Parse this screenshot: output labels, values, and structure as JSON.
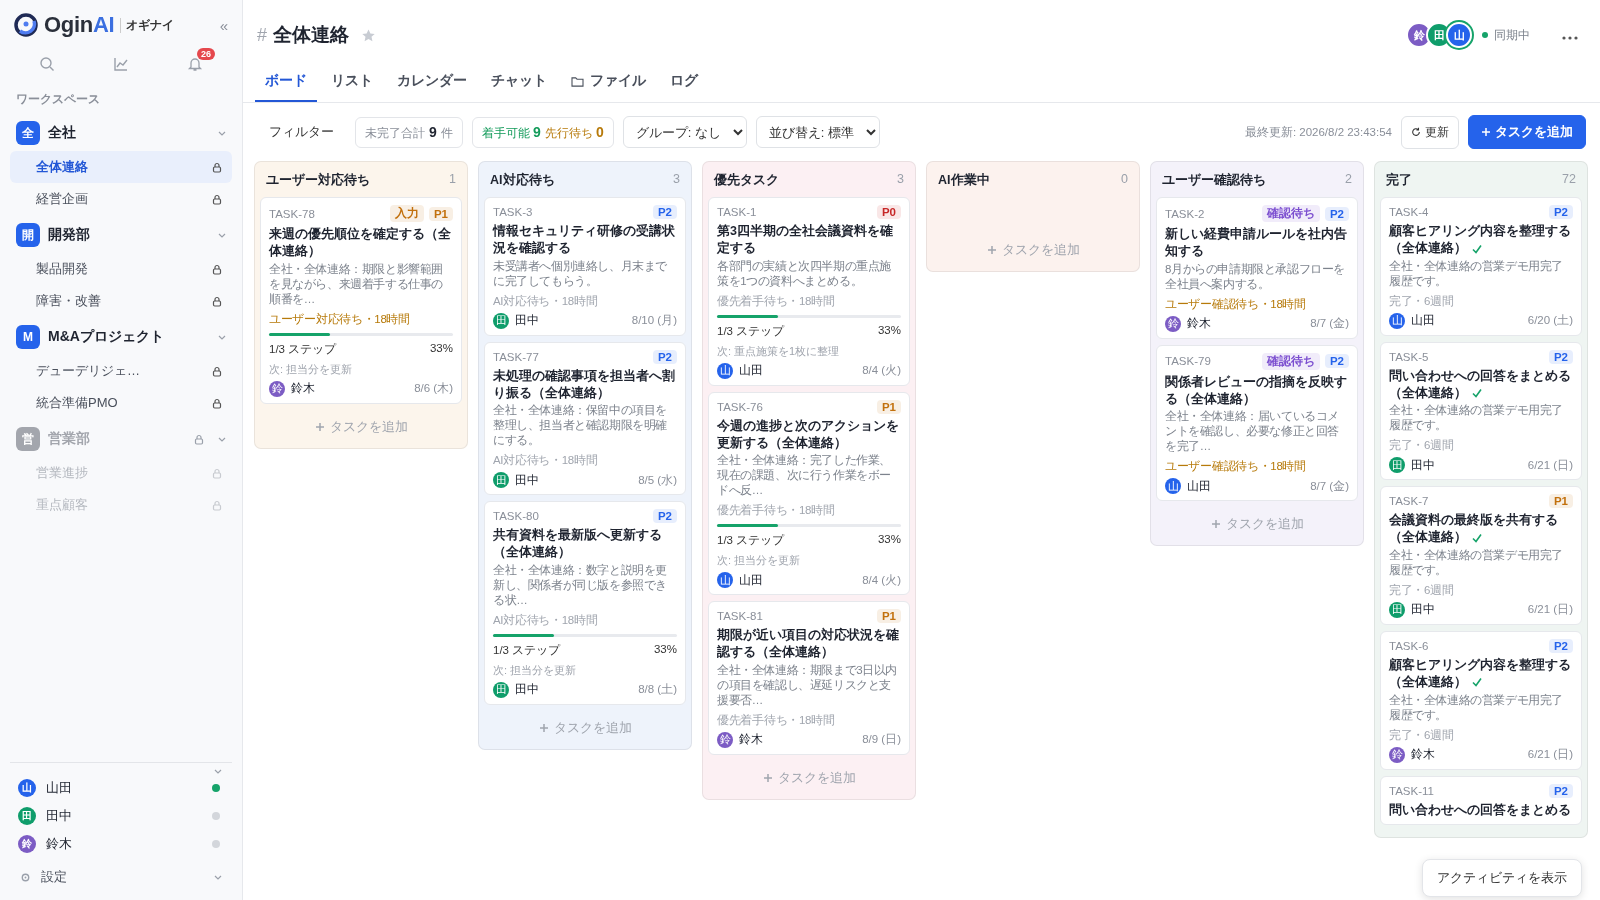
{
  "sidebar": {
    "logo": {
      "text": "Ogin",
      "accent": "AI",
      "sub": "オギナイ"
    },
    "collapse": "«",
    "notifications": "26",
    "section_label": "ワークスペース",
    "groups": [
      {
        "icon": "全",
        "name": "全社",
        "color": "#2563eb",
        "disabled": false,
        "items": [
          {
            "name": "全体連絡",
            "selected": true
          },
          {
            "name": "経営企画",
            "selected": false
          }
        ]
      },
      {
        "icon": "開",
        "name": "開発部",
        "color": "#2563eb",
        "disabled": false,
        "items": [
          {
            "name": "製品開発",
            "selected": false
          },
          {
            "name": "障害・改善",
            "selected": false
          }
        ]
      },
      {
        "icon": "M",
        "name": "M&Aプロジェクト",
        "color": "#2563eb",
        "disabled": false,
        "items": [
          {
            "name": "デューデリジェ…",
            "selected": false
          },
          {
            "name": "統合準備PMO",
            "selected": false
          }
        ]
      },
      {
        "icon": "営",
        "name": "営業部",
        "color": "#a3a6ad",
        "disabled": true,
        "locked": true,
        "items": [
          {
            "name": "営業進捗",
            "selected": false
          },
          {
            "name": "重点顧客",
            "selected": false
          }
        ]
      }
    ],
    "members": [
      {
        "initial": "山",
        "name": "山田",
        "color": "#2563eb",
        "online": true
      },
      {
        "initial": "田",
        "name": "田中",
        "color": "#0f9d6b",
        "online": false
      },
      {
        "initial": "鈴",
        "name": "鈴木",
        "color": "#7c5cc4",
        "online": false
      }
    ],
    "settings": "設定"
  },
  "header": {
    "hash": "#",
    "title": "全体連絡",
    "starred": false,
    "viewers": [
      {
        "initial": "鈴",
        "color": "#7c5cc4"
      },
      {
        "initial": "田",
        "color": "#0f9d6b"
      },
      {
        "initial": "山",
        "color": "#2563eb"
      }
    ],
    "sync": "同期中"
  },
  "tabs": [
    {
      "label": "ボード",
      "selected": true,
      "has_icon": false
    },
    {
      "label": "リスト",
      "selected": false,
      "has_icon": false
    },
    {
      "label": "カレンダー",
      "selected": false,
      "has_icon": false
    },
    {
      "label": "チャット",
      "selected": false,
      "has_icon": false
    },
    {
      "label": "ファイル",
      "selected": false,
      "has_icon": true
    },
    {
      "label": "ログ",
      "selected": false,
      "has_icon": false
    }
  ],
  "toolbar": {
    "filter": "フィルター",
    "open_total": {
      "label": "未完了合計",
      "value": "9",
      "unit": "件"
    },
    "ready": {
      "label": "着手可能",
      "value": "9"
    },
    "blocked": {
      "label": "先行待ち",
      "value": "0"
    },
    "group_select": "グループ: なし",
    "sort_select": "並び替え: 標準",
    "last_updated": "最終更新: 2026/8/2 23:43:54",
    "refresh": "更新",
    "add_task": "タスクを追加"
  },
  "columns": [
    {
      "name": "ユーザー対応待ち",
      "count": "1",
      "color": "#fcf5ec",
      "add": "タスクを追加",
      "cards": [
        {
          "id": "TASK-78",
          "tags": [
            {
              "label": "入力",
              "color": "#c2700c"
            },
            {
              "label": "P1",
              "color": "#c2700c"
            }
          ],
          "title": "来週の優先順位を確定する（全体連絡）",
          "done": false,
          "description": "全社・全体連絡：期限と影響範囲を見ながら、来週着手する仕事の順番を…",
          "status": "ユーザー対応待ち・18時間",
          "alert": true,
          "progress": {
            "level": 0.33,
            "steps": "1/3 ステップ",
            "percent": "33%"
          },
          "next": "次: 担当分を更新",
          "assignee": {
            "initial": "鈴",
            "name": "鈴木",
            "color": "#7c5cc4"
          },
          "due": "8/6 (木)"
        }
      ]
    },
    {
      "name": "AI対応待ち",
      "count": "3",
      "color": "#eef3fb",
      "add": "タスクを追加",
      "cards": [
        {
          "id": "TASK-3",
          "tags": [
            {
              "label": "P2",
              "color": "#2563eb"
            }
          ],
          "title": "情報セキュリティ研修の受講状況を確認する",
          "done": false,
          "description": "未受講者へ個別連絡し、月末までに完了してもらう。",
          "status": "AI対応待ち・18時間",
          "alert": false,
          "assignee": {
            "initial": "田",
            "name": "田中",
            "color": "#0f9d6b"
          },
          "due": "8/10 (月)"
        },
        {
          "id": "TASK-77",
          "tags": [
            {
              "label": "P2",
              "color": "#2563eb"
            }
          ],
          "title": "未処理の確認事項を担当者へ割り振る（全体連絡）",
          "done": false,
          "description": "全社・全体連絡：保留中の項目を整理し、担当者と確認期限を明確にする。",
          "status": "AI対応待ち・18時間",
          "alert": false,
          "assignee": {
            "initial": "田",
            "name": "田中",
            "color": "#0f9d6b"
          },
          "due": "8/5 (水)"
        },
        {
          "id": "TASK-80",
          "tags": [
            {
              "label": "P2",
              "color": "#2563eb"
            }
          ],
          "title": "共有資料を最新版へ更新する（全体連絡）",
          "done": false,
          "description": "全社・全体連絡：数字と説明を更新し、関係者が同じ版を参照できる状…",
          "status": "AI対応待ち・18時間",
          "alert": false,
          "progress": {
            "level": 0.33,
            "steps": "1/3 ステップ",
            "percent": "33%"
          },
          "next": "次: 担当分を更新",
          "assignee": {
            "initial": "田",
            "name": "田中",
            "color": "#0f9d6b"
          },
          "due": "8/8 (土)"
        }
      ]
    },
    {
      "name": "優先タスク",
      "count": "3",
      "color": "#fcf0f3",
      "add": "タスクを追加",
      "cards": [
        {
          "id": "TASK-1",
          "tags": [
            {
              "label": "P0",
              "color": "#c62828"
            }
          ],
          "title": "第3四半期の全社会議資料を確定する",
          "done": false,
          "description": "各部門の実績と次四半期の重点施策を1つの資料へまとめる。",
          "status": "優先着手待ち・18時間",
          "alert": false,
          "progress": {
            "level": 0.33,
            "steps": "1/3 ステップ",
            "percent": "33%"
          },
          "next": "次: 重点施策を1枚に整理",
          "assignee": {
            "initial": "山",
            "name": "山田",
            "color": "#2563eb"
          },
          "due": "8/4 (火)"
        },
        {
          "id": "TASK-76",
          "tags": [
            {
              "label": "P1",
              "color": "#c2700c"
            }
          ],
          "title": "今週の進捗と次のアクションを更新する（全体連絡）",
          "done": false,
          "description": "全社・全体連絡：完了した作業、現在の課題、次に行う作業をボードへ反…",
          "status": "優先着手待ち・18時間",
          "alert": false,
          "progress": {
            "level": 0.33,
            "steps": "1/3 ステップ",
            "percent": "33%"
          },
          "next": "次: 担当分を更新",
          "assignee": {
            "initial": "山",
            "name": "山田",
            "color": "#2563eb"
          },
          "due": "8/4 (火)"
        },
        {
          "id": "TASK-81",
          "tags": [
            {
              "label": "P1",
              "color": "#c2700c"
            }
          ],
          "title": "期限が近い項目の対応状況を確認する（全体連絡）",
          "done": false,
          "description": "全社・全体連絡：期限まで3日以内の項目を確認し、遅延リスクと支援要否…",
          "status": "優先着手待ち・18時間",
          "alert": false,
          "assignee": {
            "initial": "鈴",
            "name": "鈴木",
            "color": "#7c5cc4"
          },
          "due": "8/9 (日)"
        }
      ]
    },
    {
      "name": "AI作業中",
      "count": "0",
      "color": "#fcf2ee",
      "add": "タスクを追加"
    },
    {
      "name": "ユーザー確認待ち",
      "count": "2",
      "color": "#f4f2fa",
      "add": "タスクを追加",
      "cards": [
        {
          "id": "TASK-2",
          "tags": [
            {
              "label": "確認待ち",
              "color": "#7c4fd0"
            },
            {
              "label": "P2",
              "color": "#2563eb"
            }
          ],
          "title": "新しい経費申請ルールを社内告知する",
          "done": false,
          "description": "8月からの申請期限と承認フローを全社員へ案内する。",
          "status": "ユーザー確認待ち・18時間",
          "alert": true,
          "assignee": {
            "initial": "鈴",
            "name": "鈴木",
            "color": "#7c5cc4"
          },
          "due": "8/7 (金)"
        },
        {
          "id": "TASK-79",
          "tags": [
            {
              "label": "確認待ち",
              "color": "#7c4fd0"
            },
            {
              "label": "P2",
              "color": "#2563eb"
            }
          ],
          "title": "関係者レビューの指摘を反映する（全体連絡）",
          "done": false,
          "description": "全社・全体連絡：届いているコメントを確認し、必要な修正と回答を完了…",
          "status": "ユーザー確認待ち・18時間",
          "alert": true,
          "assignee": {
            "initial": "山",
            "name": "山田",
            "color": "#2563eb"
          },
          "due": "8/7 (金)"
        }
      ]
    },
    {
      "name": "完了",
      "count": "72",
      "color": "#eff5f2",
      "cards": [
        {
          "id": "TASK-4",
          "tags": [
            {
              "label": "P2",
              "color": "#2563eb"
            }
          ],
          "title": "顧客ヒアリング内容を整理する（全体連絡）",
          "done": true,
          "description": "全社・全体連絡の営業デモ用完了履歴です。",
          "status": "完了・6週間",
          "alert": false,
          "assignee": {
            "initial": "山",
            "name": "山田",
            "color": "#2563eb"
          },
          "due": "6/20 (土)"
        },
        {
          "id": "TASK-5",
          "tags": [
            {
              "label": "P2",
              "color": "#2563eb"
            }
          ],
          "title": "問い合わせへの回答をまとめる（全体連絡）",
          "done": true,
          "description": "全社・全体連絡の営業デモ用完了履歴です。",
          "status": "完了・6週間",
          "alert": false,
          "assignee": {
            "initial": "田",
            "name": "田中",
            "color": "#0f9d6b"
          },
          "due": "6/21 (日)"
        },
        {
          "id": "TASK-7",
          "tags": [
            {
              "label": "P1",
              "color": "#c2700c"
            }
          ],
          "title": "会議資料の最終版を共有する（全体連絡）",
          "done": true,
          "description": "全社・全体連絡の営業デモ用完了履歴です。",
          "status": "完了・6週間",
          "alert": false,
          "assignee": {
            "initial": "田",
            "name": "田中",
            "color": "#0f9d6b"
          },
          "due": "6/21 (日)"
        },
        {
          "id": "TASK-6",
          "tags": [
            {
              "label": "P2",
              "color": "#2563eb"
            }
          ],
          "title": "顧客ヒアリング内容を整理する（全体連絡）",
          "done": true,
          "description": "全社・全体連絡の営業デモ用完了履歴です。",
          "status": "完了・6週間",
          "alert": false,
          "assignee": {
            "initial": "鈴",
            "name": "鈴木",
            "color": "#7c5cc4"
          },
          "due": "6/21 (日)"
        },
        {
          "id": "TASK-11",
          "tags": [
            {
              "label": "P2",
              "color": "#2563eb"
            }
          ],
          "title": "問い合わせへの回答をまとめる"
        }
      ]
    }
  ],
  "activity_button": "アクティビティを表示"
}
